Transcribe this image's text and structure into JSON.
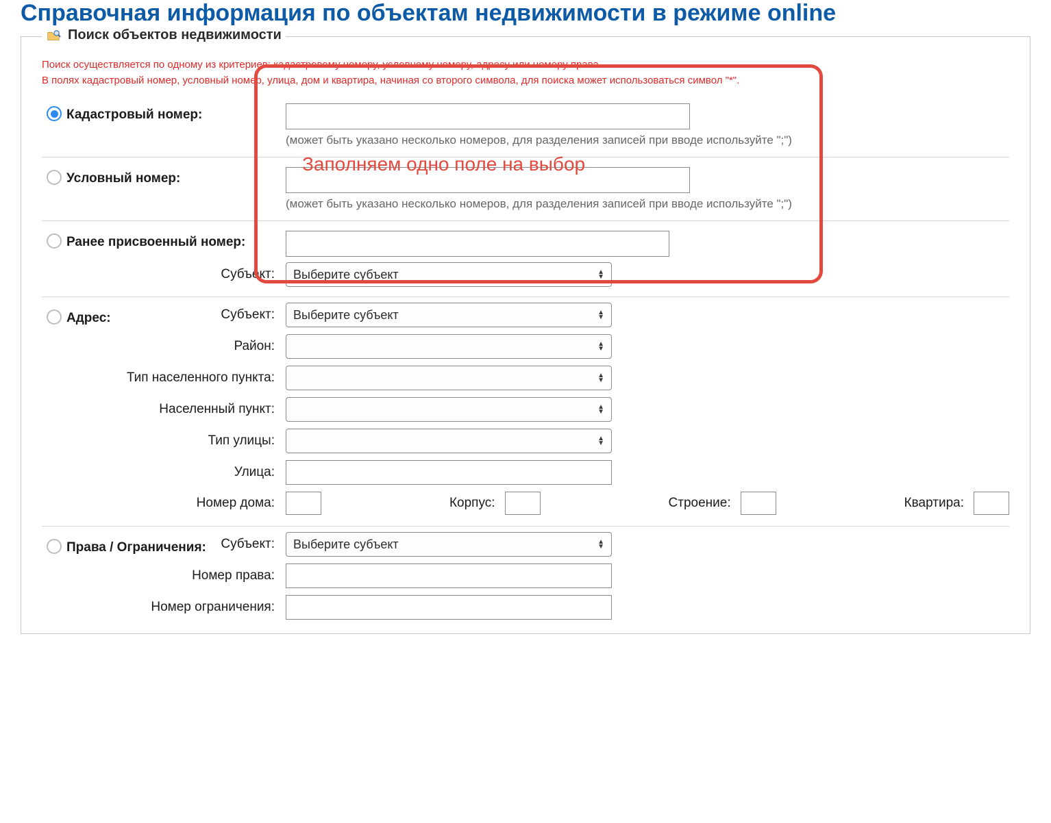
{
  "page": {
    "title": "Справочная информация по объектам недвижимости в режиме online"
  },
  "panel": {
    "legend": "Поиск объектов недвижимости"
  },
  "notes": {
    "line1": "Поиск осуществляется по одному из критериев: кадастровому номеру, условному номеру, адресу или номеру права.",
    "line2": "В полях кадастровый номер, условный номер, улица, дом и квартира, начиная со второго символа, для поиска может использоваться символ \"*\"."
  },
  "criteria": {
    "cadastral": {
      "label": "Кадастровый номер:",
      "hint": "(может быть указано несколько номеров, для разделения записей при вводе используйте \";\")",
      "value": ""
    },
    "conditional": {
      "label": "Условный номер:",
      "hint": "(может быть указано несколько номеров, для разделения записей при вводе используйте \";\")",
      "value": ""
    },
    "previous": {
      "label": "Ранее присвоенный номер:",
      "value": "",
      "subject_label": "Субъект:",
      "subject_value": "Выберите субъект"
    },
    "address": {
      "label": "Адрес:",
      "subject_label": "Субъект:",
      "subject_value": "Выберите субъект",
      "district_label": "Район:",
      "district_value": "",
      "settlement_type_label": "Тип населенного пункта:",
      "settlement_type_value": "",
      "settlement_label": "Населенный пункт:",
      "settlement_value": "",
      "street_type_label": "Тип улицы:",
      "street_type_value": "",
      "street_label": "Улица:",
      "street_value": "",
      "house_label": "Номер дома:",
      "house_value": "",
      "korpus_label": "Корпус:",
      "korpus_value": "",
      "building_label": "Строение:",
      "building_value": "",
      "apartment_label": "Квартира:",
      "apartment_value": ""
    },
    "rights": {
      "label": "Права / Ограничения:",
      "subject_label": "Субъект:",
      "subject_value": "Выберите субъект",
      "right_number_label": "Номер права:",
      "right_number_value": "",
      "restriction_number_label": "Номер ограничения:",
      "restriction_number_value": ""
    }
  },
  "annotation": {
    "text": "Заполняем одно поле на выбор"
  }
}
